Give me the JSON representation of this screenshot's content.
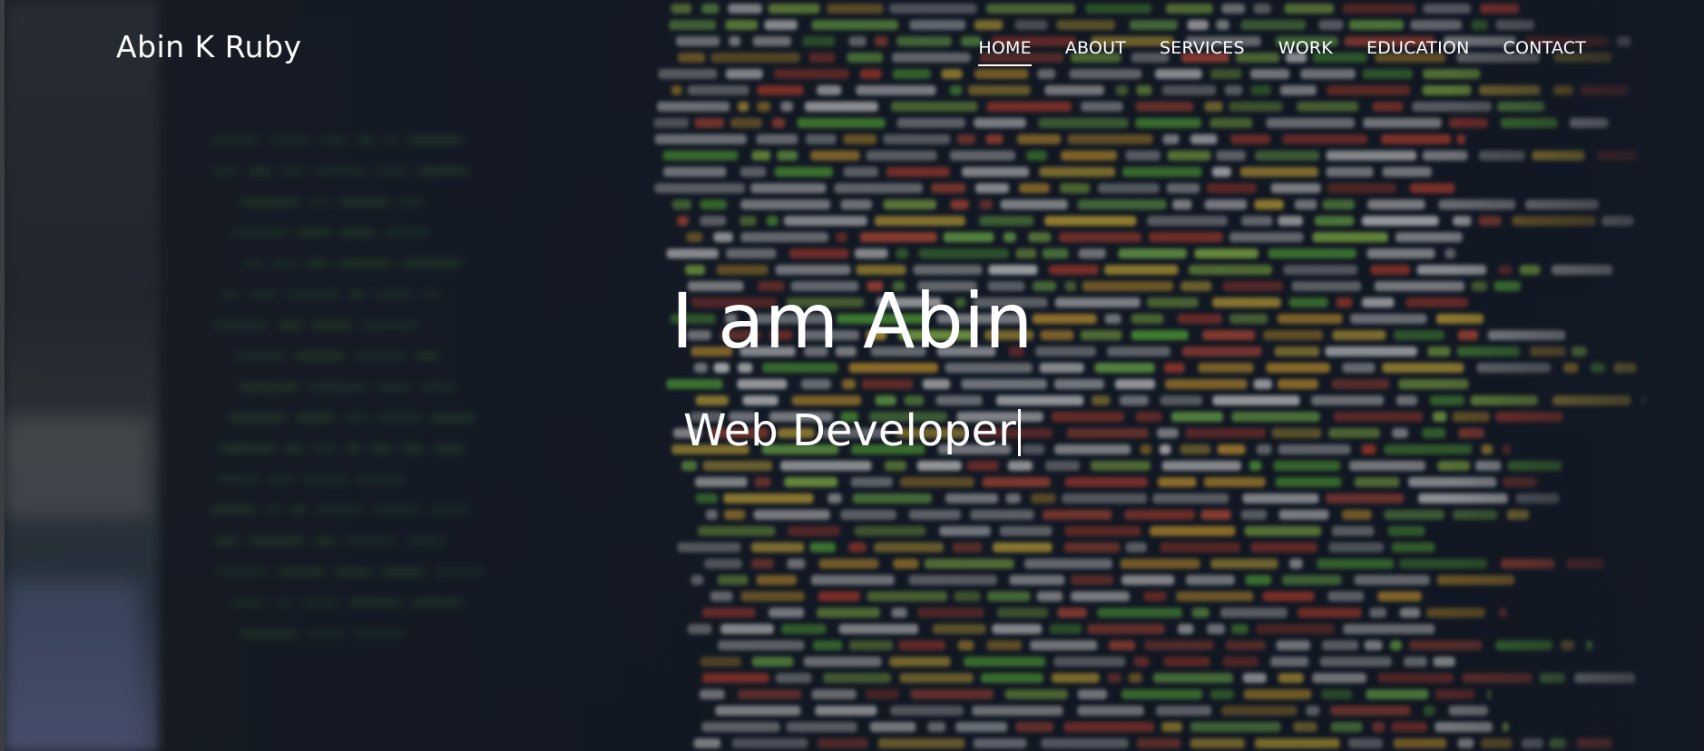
{
  "site": {
    "brand": "Abin K Ruby"
  },
  "nav": {
    "items": [
      {
        "label": "HOME",
        "active": true
      },
      {
        "label": "ABOUT",
        "active": false
      },
      {
        "label": "SERVICES",
        "active": false
      },
      {
        "label": "WORK",
        "active": false
      },
      {
        "label": "EDUCATION",
        "active": false
      },
      {
        "label": "CONTACT",
        "active": false
      }
    ]
  },
  "hero": {
    "headline": "I am Abin",
    "typed_text": "Web Developer",
    "background": "blurred-code-screen-image"
  },
  "colors": {
    "text": "#ffffff",
    "overlay": "#141a25"
  }
}
